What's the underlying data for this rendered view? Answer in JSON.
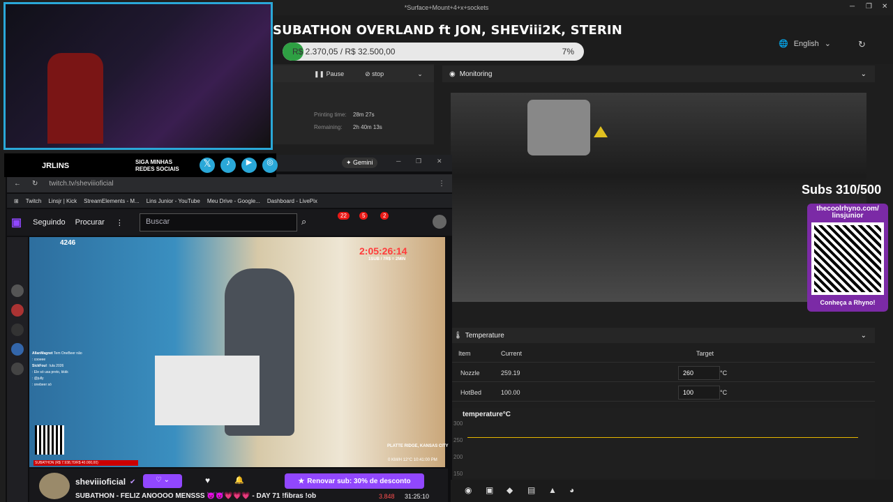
{
  "window": {
    "title": "*Surface+Mount+4+x+sockets"
  },
  "header": {
    "title": "SUBATHON OVERLAND ft JON, SHEViii2K, STERIN",
    "goal_text": "R$ 2.370,05 / R$ 32.500,00",
    "goal_percent": "7%",
    "goal_fraction": 0.07,
    "language": "English"
  },
  "printer": {
    "pause_label": "Pause",
    "stop_label": "stop",
    "printing_time_label": "Printing time:",
    "printing_time_value": "28m 27s",
    "remaining_label": "Remaining:",
    "remaining_value": "2h 40m 13s"
  },
  "monitoring": {
    "title": "Monitoring"
  },
  "overlay": {
    "subs": "Subs 310/500",
    "qr_url": "thecoolrhyno.com/ linsjunior",
    "qr_caption": "Conheça a Rhyno!",
    "brand": "JRLINS",
    "social": "SIGA MINHAS REDES SOCIAIS"
  },
  "temperature": {
    "title": "Temperature",
    "col_item": "Item",
    "col_current": "Current",
    "col_target": "Target",
    "rows": [
      {
        "item": "Nozzle",
        "current": "259.19",
        "target": "260",
        "unit": "°C"
      },
      {
        "item": "HotBed",
        "current": "100.00",
        "target": "100",
        "unit": "°C"
      }
    ],
    "chart_title": "temperature°C",
    "y_ticks": [
      "300",
      "250",
      "200",
      "150"
    ]
  },
  "browser": {
    "gemini": "Gemini",
    "url": "twitch.tv/sheviiioficial",
    "bookmarks": [
      "Twitch",
      "Linsjr | Kick",
      "StreamElements - M...",
      "Lins Junior - YouTube",
      "Meu Drive - Google...",
      "Dashboard - LivePix"
    ]
  },
  "twitch": {
    "following": "Seguindo",
    "browse": "Procurar",
    "search_placeholder": "Buscar",
    "badges": [
      "22",
      "5",
      "2"
    ],
    "viewers": "4246",
    "timer": "2:05:26:14",
    "timer_sub": "1SUB / 7R$ = 2MIN",
    "location": "PLATTE RIDGE, KANSAS CITY",
    "stream_info": "0 KM/H  12°C  10:41:00 PM",
    "streamer": "sheviiioficial",
    "renew_label": "Renovar sub: 30% de desconto",
    "stream_title": "SUBATHON - FELIZ ANOOOO MENSSS 😈😈💗💗💗 - DAY 71 !fibras !ob",
    "overlay_goal": "SUBATHON (R$ 7.938,70/R$ 40.000,00)",
    "counter": "3.848",
    "uptime": "31:25:10"
  },
  "chat": [
    {
      "user": "AllanMagnet",
      "msg": "Tem OneBeer não"
    },
    {
      "user": "",
      "msg": ": cooeee"
    },
    {
      "user": "SickFoul",
      "msg": ": lula 2026"
    },
    {
      "user": "",
      "msg": ": Ele só usa preto, kkkk"
    },
    {
      "user": "",
      "msg": ": @jully"
    },
    {
      "user": "",
      "msg": ": onebeer só"
    }
  ],
  "colors": {
    "accent": "#2ea043",
    "twitch": "#9147ff",
    "timer": "#ff3b3b"
  }
}
